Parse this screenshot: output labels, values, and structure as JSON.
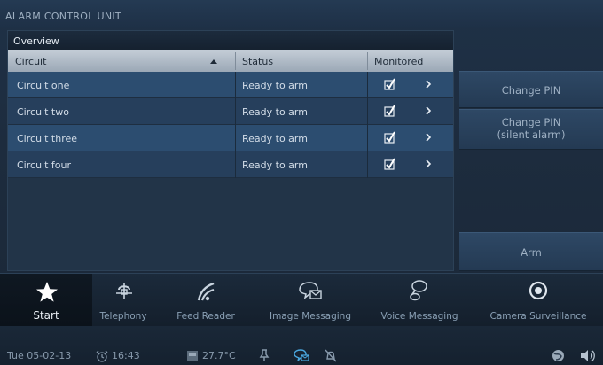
{
  "window": {
    "title": "ALARM CONTROL UNIT"
  },
  "panel": {
    "title": "Overview",
    "columns": {
      "circuit": "Circuit",
      "status": "Status",
      "monitored": "Monitored"
    },
    "rows": [
      {
        "circuit": "Circuit one",
        "status": "Ready to arm",
        "monitored": true
      },
      {
        "circuit": "Circuit two",
        "status": "Ready to arm",
        "monitored": true
      },
      {
        "circuit": "Circuit three",
        "status": "Ready to arm",
        "monitored": true
      },
      {
        "circuit": "Circuit four",
        "status": "Ready to arm",
        "monitored": true
      }
    ]
  },
  "side_buttons": {
    "change_pin": "Change PIN",
    "change_pin_silent_1": "Change PIN",
    "change_pin_silent_2": "(silent alarm)",
    "arm": "Arm"
  },
  "nav": {
    "start": "Start",
    "telephony": "Telephony",
    "feed_reader": "Feed Reader",
    "image_messaging": "Image Messaging",
    "voice_messaging": "Voice Messaging",
    "camera_surveillance": "Camera Surveillance"
  },
  "status_bar": {
    "date": "Tue 05-02-13",
    "time": "16:43",
    "temperature": "27.7°C"
  },
  "colors": {
    "accent": "#4aa8e0",
    "row_a": "#2c4d70",
    "row_b": "#263f5c",
    "header": "#b3bfcb"
  }
}
